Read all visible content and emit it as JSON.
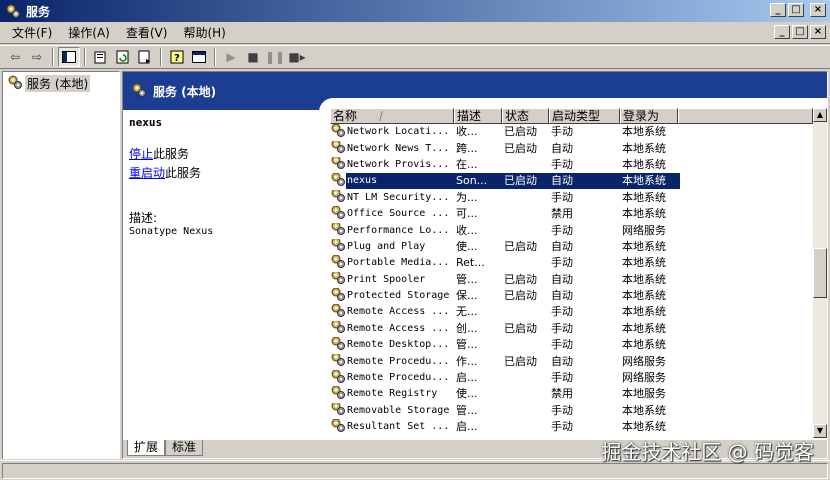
{
  "window": {
    "title": "服务"
  },
  "menu": [
    "文件(F)",
    "操作(A)",
    "查看(V)",
    "帮助(H)"
  ],
  "tree": {
    "root": "服务 (本地)"
  },
  "header": {
    "title": "服务 (本地)"
  },
  "detail": {
    "service": "nexus",
    "stop_link": "停止",
    "stop_suffix": "此服务",
    "restart_link": "重启动",
    "restart_suffix": "此服务",
    "desc_label": "描述:",
    "desc_value": "Sonatype Nexus"
  },
  "columns": {
    "name": "名称",
    "sort_glyph": "/",
    "desc": "描述",
    "status": "状态",
    "start": "启动类型",
    "logon": "登录为"
  },
  "rows": [
    {
      "name": "Network Locati...",
      "desc": "收...",
      "status": "已启动",
      "start": "手动",
      "logon": "本地系统"
    },
    {
      "name": "Network News T...",
      "desc": "跨...",
      "status": "已启动",
      "start": "自动",
      "logon": "本地系统"
    },
    {
      "name": "Network Provis...",
      "desc": "在...",
      "status": "",
      "start": "手动",
      "logon": "本地系统"
    },
    {
      "name": "nexus",
      "desc": "Son...",
      "status": "已启动",
      "start": "自动",
      "logon": "本地系统",
      "selected": true
    },
    {
      "name": "NT LM Security...",
      "desc": "为...",
      "status": "",
      "start": "手动",
      "logon": "本地系统"
    },
    {
      "name": "Office Source ...",
      "desc": "可...",
      "status": "",
      "start": "禁用",
      "logon": "本地系统"
    },
    {
      "name": "Performance Lo...",
      "desc": "收...",
      "status": "",
      "start": "手动",
      "logon": "网络服务"
    },
    {
      "name": "Plug and Play",
      "desc": "使...",
      "status": "已启动",
      "start": "自动",
      "logon": "本地系统"
    },
    {
      "name": "Portable Media...",
      "desc": "Ret...",
      "status": "",
      "start": "手动",
      "logon": "本地系统"
    },
    {
      "name": "Print Spooler",
      "desc": "管...",
      "status": "已启动",
      "start": "自动",
      "logon": "本地系统"
    },
    {
      "name": "Protected Storage",
      "desc": "保...",
      "status": "已启动",
      "start": "自动",
      "logon": "本地系统"
    },
    {
      "name": "Remote Access ...",
      "desc": "无...",
      "status": "",
      "start": "手动",
      "logon": "本地系统"
    },
    {
      "name": "Remote Access ...",
      "desc": "创...",
      "status": "已启动",
      "start": "手动",
      "logon": "本地系统"
    },
    {
      "name": "Remote Desktop...",
      "desc": "管...",
      "status": "",
      "start": "手动",
      "logon": "本地系统"
    },
    {
      "name": "Remote Procedu...",
      "desc": "作...",
      "status": "已启动",
      "start": "自动",
      "logon": "网络服务"
    },
    {
      "name": "Remote Procedu...",
      "desc": "启...",
      "status": "",
      "start": "手动",
      "logon": "网络服务"
    },
    {
      "name": "Remote Registry",
      "desc": "使...",
      "status": "",
      "start": "禁用",
      "logon": "本地服务"
    },
    {
      "name": "Removable Storage",
      "desc": "管...",
      "status": "",
      "start": "手动",
      "logon": "本地系统"
    },
    {
      "name": "Resultant Set ...",
      "desc": "启...",
      "status": "",
      "start": "手动",
      "logon": "本地系统"
    }
  ],
  "tabs": [
    "扩展",
    "标准"
  ],
  "watermark": "掘金技术社区 @ 码觉客",
  "colors": {
    "title_bar": "#0a246a",
    "header_band": "#1c3e92",
    "selection": "#0a246a",
    "link": "#0000ff"
  }
}
